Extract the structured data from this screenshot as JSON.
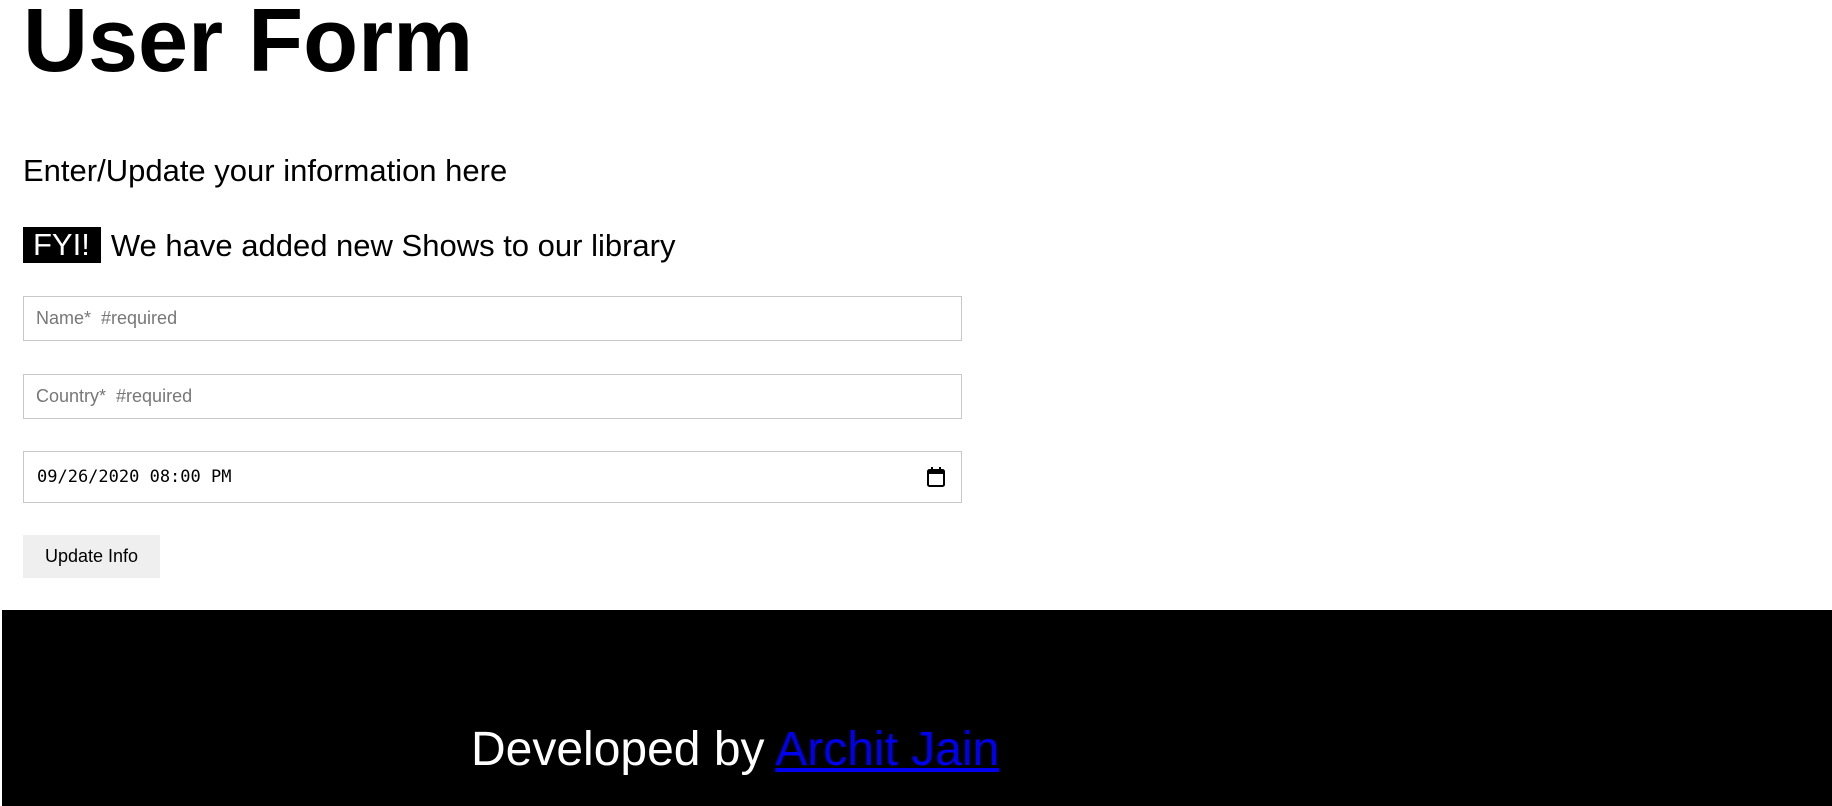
{
  "header": {
    "title": "User Form",
    "subtitle": "Enter/Update your information here"
  },
  "notice": {
    "badge": "FYI!",
    "text": "We have added new Shows to our library"
  },
  "form": {
    "name_placeholder": "Name*  #required",
    "name_value": "",
    "country_placeholder": "Country*  #required",
    "country_value": "",
    "datetime_value": "09/26/2020 08:00 PM",
    "submit_label": "Update Info"
  },
  "footer": {
    "prefix": "Developed by",
    "author_link": "Archit Jain"
  },
  "colors": {
    "footer_bg": "#000000",
    "badge_bg": "#000000",
    "link": "#0000ee",
    "button_bg": "#efefef",
    "input_border": "#c8c8c8"
  },
  "icons": {
    "datetime_picker": "calendar-icon"
  }
}
